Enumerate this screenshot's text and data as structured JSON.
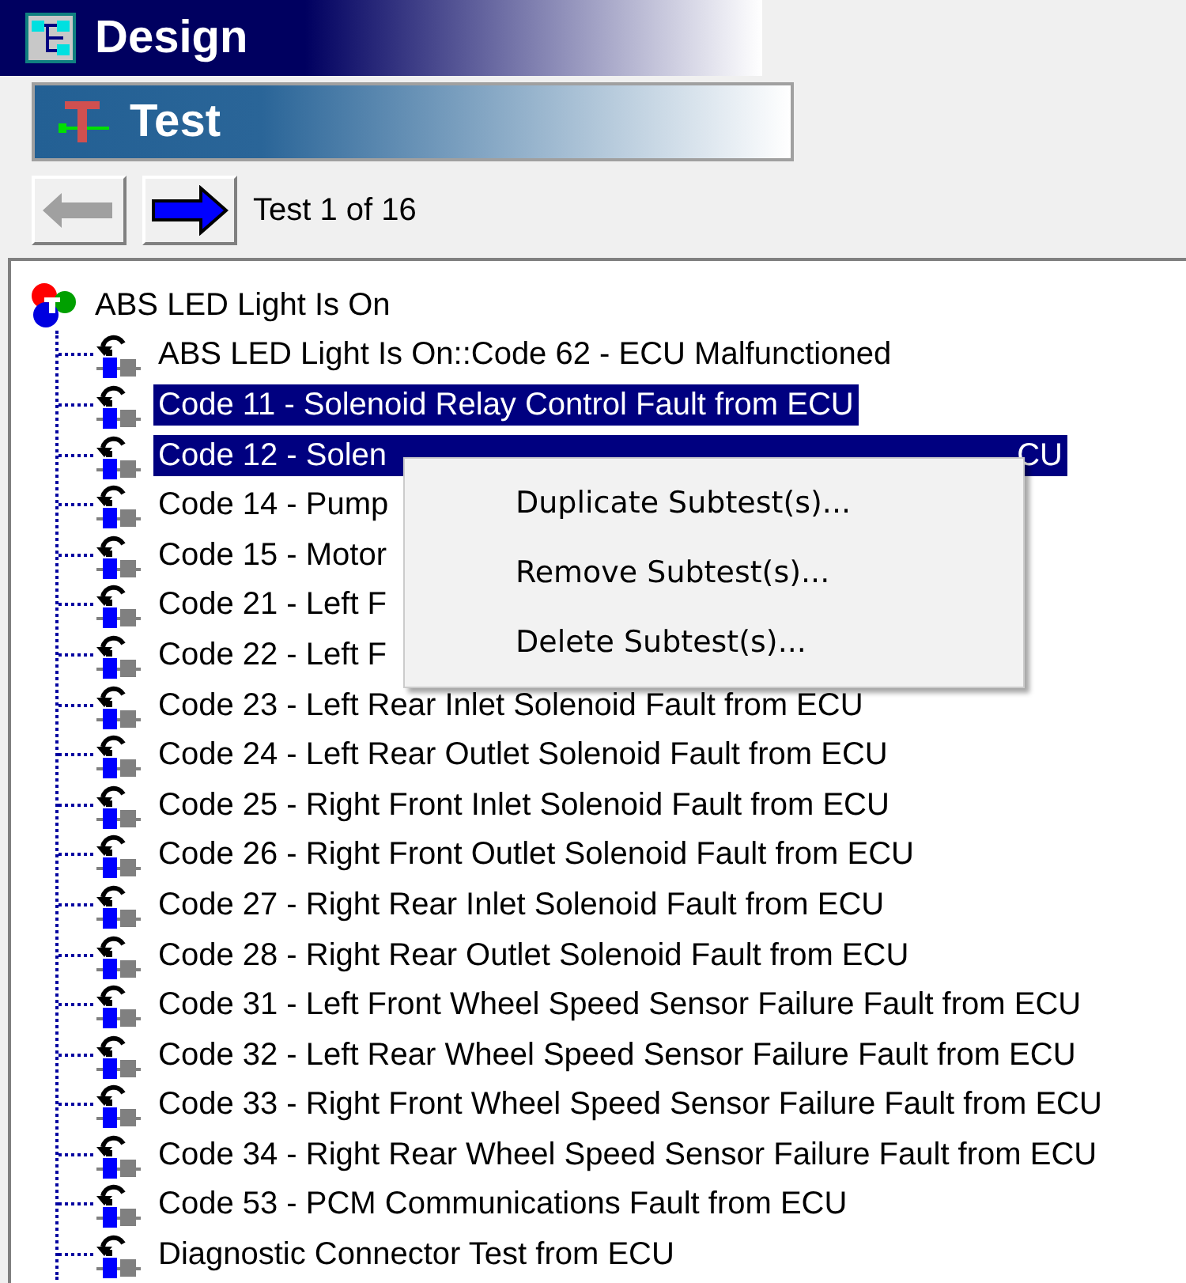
{
  "design_bar": {
    "title": "Design"
  },
  "test_bar": {
    "title": "Test"
  },
  "navigation": {
    "back_disabled": true,
    "forward_disabled": false,
    "counter": "Test 1 of 16"
  },
  "tree": {
    "label": "ABS LED Light Is On",
    "children": [
      {
        "label": "ABS LED Light Is On::Code 62 - ECU Malfunctioned",
        "selected": false
      },
      {
        "label": "Code 11 - Solenoid Relay Control Fault from ECU",
        "selected": true
      },
      {
        "label": "Code 12 - Solen",
        "label_end": "CU",
        "selected": true
      },
      {
        "label": "Code 14 - Pump",
        "selected": false
      },
      {
        "label": "Code 15 - Motor",
        "selected": false
      },
      {
        "label": "Code 21 - Left F",
        "selected": false
      },
      {
        "label": "Code 22 - Left F",
        "selected": false
      },
      {
        "label": "Code 23 - Left Rear Inlet Solenoid Fault from ECU",
        "selected": false
      },
      {
        "label": "Code 24 - Left Rear Outlet Solenoid Fault from ECU",
        "selected": false
      },
      {
        "label": "Code 25 - Right Front Inlet Solenoid Fault from ECU",
        "selected": false
      },
      {
        "label": "Code 26 - Right Front Outlet Solenoid Fault from ECU",
        "selected": false
      },
      {
        "label": "Code 27 - Right Rear Inlet Solenoid Fault from ECU",
        "selected": false
      },
      {
        "label": "Code 28 - Right Rear Outlet Solenoid Fault from ECU",
        "selected": false
      },
      {
        "label": "Code 31 - Left Front Wheel Speed Sensor Failure Fault from ECU",
        "selected": false
      },
      {
        "label": "Code 32 - Left Rear Wheel Speed Sensor Failure Fault from ECU",
        "selected": false
      },
      {
        "label": "Code 33 - Right Front Wheel Speed Sensor Failure Fault from ECU",
        "selected": false
      },
      {
        "label": "Code 34 - Right Rear Wheel Speed Sensor Failure Fault from ECU",
        "selected": false
      },
      {
        "label": "Code 53 - PCM Communications Fault from ECU",
        "selected": false
      },
      {
        "label": "Diagnostic Connector Test from ECU",
        "selected": false
      }
    ]
  },
  "context_menu": {
    "items": [
      "Duplicate Subtest(s)...",
      "Remove Subtest(s)...",
      "Delete Subtest(s)..."
    ]
  }
}
